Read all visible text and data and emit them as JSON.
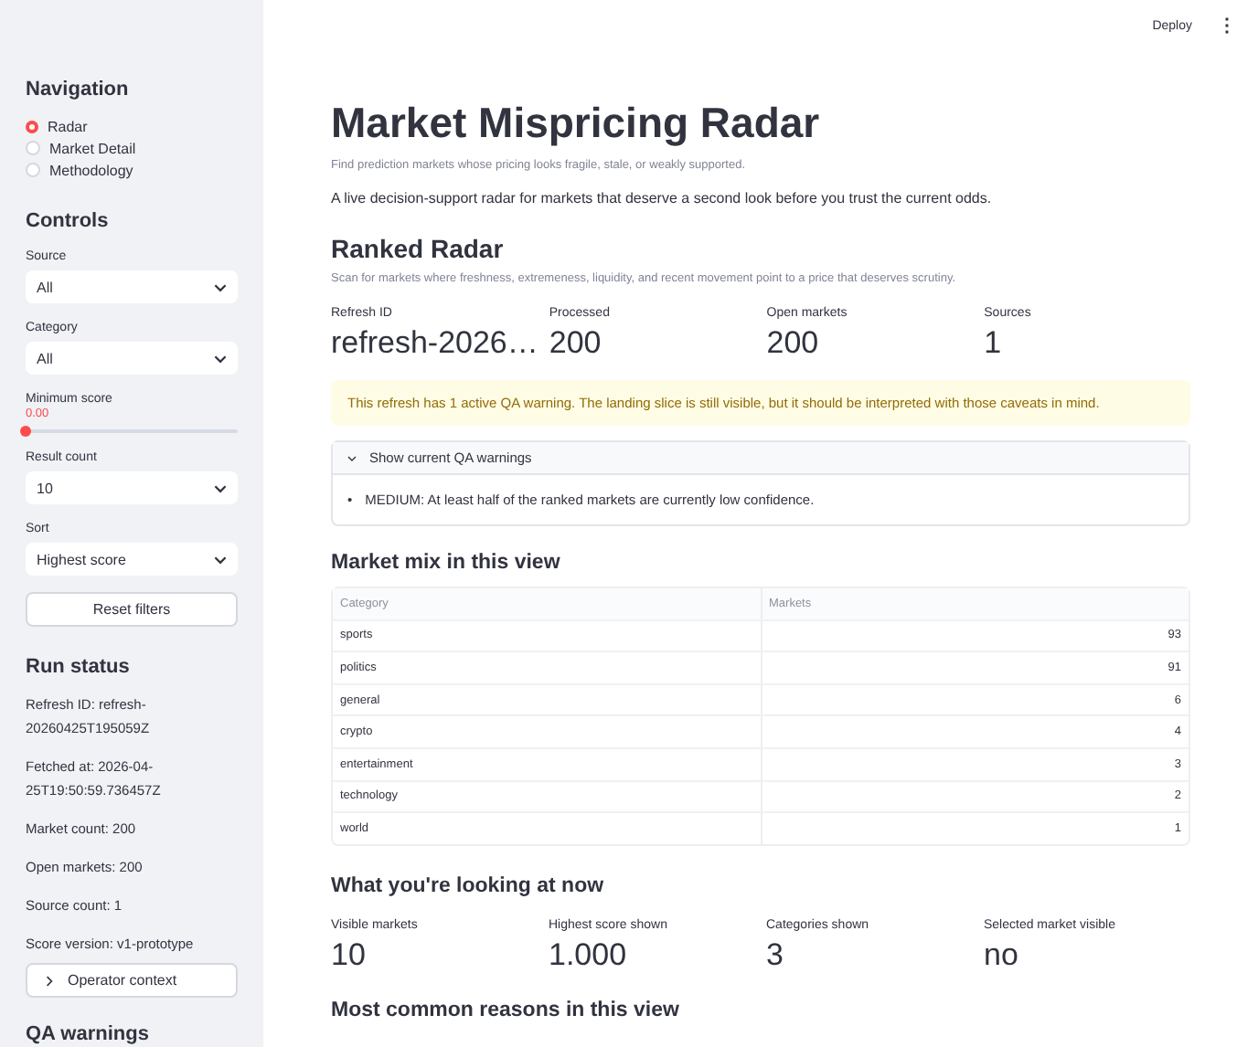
{
  "toolbar": {
    "deploy": "Deploy",
    "menu": "⋮"
  },
  "sidebar": {
    "navigation": {
      "title": "Navigation",
      "items": [
        {
          "label": "Radar",
          "selected": true
        },
        {
          "label": "Market Detail",
          "selected": false
        },
        {
          "label": "Methodology",
          "selected": false
        }
      ]
    },
    "controls": {
      "title": "Controls",
      "fields": [
        {
          "kind": "select",
          "label": "Source",
          "value": "All"
        },
        {
          "kind": "select",
          "label": "Category",
          "value": "All"
        },
        {
          "kind": "slider",
          "label": "Minimum score",
          "reading": "0.00",
          "level": 0
        },
        {
          "kind": "select",
          "label": "Result count",
          "value": "10"
        },
        {
          "kind": "select",
          "label": "Sort",
          "value": "Highest score"
        }
      ],
      "reset": "Reset filters"
    },
    "run_status": {
      "title": "Run status",
      "lines": [
        "Refresh ID: refresh-20260425T195059Z",
        "Fetched at: 2026-04-25T19:50:59.736457Z",
        "Market count: 200",
        "Open markets: 200",
        "Source count: 1",
        "Score version: v1-prototype"
      ]
    },
    "operator": {
      "label": "Operator context",
      "expanded": false
    },
    "qa_title": "QA warnings"
  },
  "main": {
    "title": "Market Mispricing Radar",
    "caption": "Find prediction markets whose pricing looks fragile, stale, or weakly supported.",
    "intro": "A live decision-support radar for markets that deserve a second look before you trust the current odds.",
    "ranked": {
      "title": "Ranked Radar",
      "caption": "Scan for markets where freshness, extremeness, liquidity, and recent movement point to a price that deserves scrutiny.",
      "metrics": [
        {
          "label": "Refresh ID",
          "value": "refresh-2026…"
        },
        {
          "label": "Processed",
          "value": "200"
        },
        {
          "label": "Open markets",
          "value": "200"
        },
        {
          "label": "Sources",
          "value": "1"
        }
      ]
    },
    "warning": "This refresh has 1 active QA warning. The landing slice is still visible, but it should be interpreted with those caveats in mind.",
    "expander": {
      "label": "Show current QA warnings",
      "expanded": true,
      "bullet": "•",
      "items": [
        "MEDIUM: At least half of the ranked markets are currently low confidence."
      ]
    },
    "mix": {
      "title": "Market mix in this view",
      "columns": [
        "Category",
        "Markets"
      ],
      "rows": [
        [
          "sports",
          "93"
        ],
        [
          "politics",
          "91"
        ],
        [
          "general",
          "6"
        ],
        [
          "crypto",
          "4"
        ],
        [
          "entertainment",
          "3"
        ],
        [
          "technology",
          "2"
        ],
        [
          "world",
          "1"
        ]
      ]
    },
    "now": {
      "title": "What you're looking at now",
      "metrics": [
        {
          "label": "Visible markets",
          "value": "10"
        },
        {
          "label": "Highest score shown",
          "value": "1.000"
        },
        {
          "label": "Categories shown",
          "value": "3"
        },
        {
          "label": "Selected market visible",
          "value": "no"
        }
      ]
    },
    "reasons_title": "Most common reasons in this view"
  }
}
